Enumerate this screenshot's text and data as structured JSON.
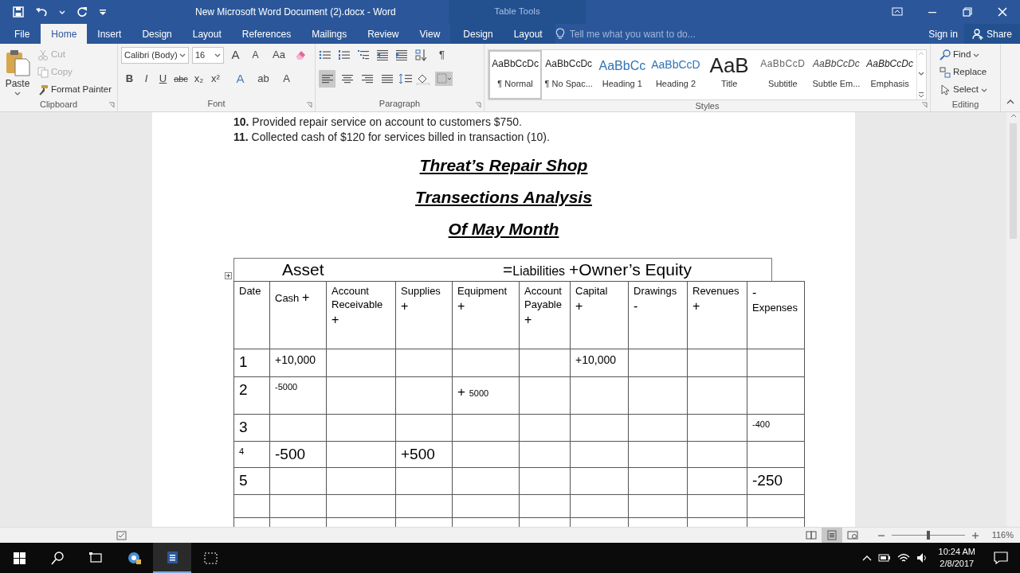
{
  "window": {
    "title": "New Microsoft Word Document (2).docx - Word",
    "context": "Table Tools"
  },
  "tabs": [
    {
      "label": "File",
      "selected": false,
      "kind": "file"
    },
    {
      "label": "Home",
      "selected": true,
      "kind": "main"
    },
    {
      "label": "Insert",
      "selected": false,
      "kind": "main"
    },
    {
      "label": "Design",
      "selected": false,
      "kind": "main"
    },
    {
      "label": "Layout",
      "selected": false,
      "kind": "main"
    },
    {
      "label": "References",
      "selected": false,
      "kind": "main"
    },
    {
      "label": "Mailings",
      "selected": false,
      "kind": "main"
    },
    {
      "label": "Review",
      "selected": false,
      "kind": "main"
    },
    {
      "label": "View",
      "selected": false,
      "kind": "main"
    },
    {
      "label": "Design",
      "selected": false,
      "kind": "context"
    },
    {
      "label": "Layout",
      "selected": false,
      "kind": "context"
    }
  ],
  "tell_me": {
    "placeholder": "Tell me what you want to do..."
  },
  "account": {
    "sign_in": "Sign in",
    "share": "Share"
  },
  "ribbon": {
    "clipboard": {
      "label": "Clipboard",
      "paste": "Paste",
      "commands": [
        {
          "label": "Cut",
          "kind": "cut",
          "disabled": true
        },
        {
          "label": "Copy",
          "kind": "copy",
          "disabled": true
        },
        {
          "label": "Format Painter",
          "kind": "painter",
          "disabled": false
        }
      ]
    },
    "font": {
      "label": "Font",
      "name": "Calibri (Body)",
      "size": "16",
      "tools": [
        {
          "glyph": "A",
          "kind": "grow"
        },
        {
          "glyph": "A",
          "kind": "shrink"
        },
        {
          "glyph": "Aa",
          "kind": "case"
        }
      ],
      "format": [
        {
          "glyph": "B",
          "kind": "bold"
        },
        {
          "glyph": "I",
          "kind": "italic"
        },
        {
          "glyph": "U",
          "kind": "underline"
        },
        {
          "glyph": "abc",
          "kind": "strike"
        },
        {
          "glyph": "x₂",
          "kind": "sub"
        },
        {
          "glyph": "x²",
          "kind": "sup"
        },
        {
          "glyph": "A",
          "kind": "effects"
        },
        {
          "glyph": "ab",
          "kind": "highlight"
        },
        {
          "glyph": "A",
          "kind": "color"
        }
      ]
    },
    "paragraph": {
      "label": "Paragraph",
      "pilcrow": "¶",
      "alignments": [
        {
          "kind": "left",
          "selected": true
        },
        {
          "kind": "center",
          "selected": false
        },
        {
          "kind": "right",
          "selected": false
        },
        {
          "kind": "justify",
          "selected": false
        }
      ]
    },
    "styles": {
      "label": "Styles",
      "items": [
        {
          "preview": "AaBbCcDc",
          "name": "¶ Normal",
          "kind": "normal",
          "selected": true
        },
        {
          "preview": "AaBbCcDc",
          "name": "¶ No Spac...",
          "kind": "nospacing",
          "selected": false
        },
        {
          "preview": "AaBbCc",
          "name": "Heading 1",
          "kind": "heading1",
          "selected": false
        },
        {
          "preview": "AaBbCcD",
          "name": "Heading 2",
          "kind": "heading2",
          "selected": false
        },
        {
          "preview": "AaB",
          "name": "Title",
          "kind": "title",
          "selected": false
        },
        {
          "preview": "AaBbCcD",
          "name": "Subtitle",
          "kind": "subtitle",
          "selected": false
        },
        {
          "preview": "AaBbCcDc",
          "name": "Subtle Em...",
          "kind": "subtle",
          "selected": false
        },
        {
          "preview": "AaBbCcDc",
          "name": "Emphasis",
          "kind": "emphasis",
          "selected": false
        }
      ]
    },
    "editing": {
      "label": "Editing",
      "commands": [
        {
          "label": "Find",
          "kind": "find"
        },
        {
          "label": "Replace",
          "kind": "replace"
        },
        {
          "label": "Select",
          "kind": "select"
        }
      ]
    }
  },
  "document": {
    "list": [
      {
        "number": "10.",
        "text": "Provided repair service on account to customers $750."
      },
      {
        "number": "11.",
        "text": "Collected cash of $120 for services billed in transaction (10)."
      }
    ],
    "headings": [
      "Threat’s Repair Shop",
      "Transections Analysis",
      "Of May Month"
    ],
    "table": {
      "equation": {
        "asset": "Asset",
        "equals": "=",
        "liabilities": "Liabilities",
        "equity": "+Owner’s Equity"
      },
      "columns": [
        {
          "label": "Date",
          "kind": "plain"
        },
        {
          "label": "Cash",
          "sign": "+",
          "kind": "inline"
        },
        {
          "label": "Account Receivable",
          "sign": "+",
          "kind": "below"
        },
        {
          "label": "Supplies",
          "sign": "+",
          "kind": "below"
        },
        {
          "label": "Equipment",
          "sign": "+",
          "kind": "below"
        },
        {
          "label": "Account Payable",
          "sign": "+",
          "kind": "below"
        },
        {
          "label": "Capital",
          "sign": "+",
          "kind": "below"
        },
        {
          "label": "Drawings",
          "sign": "-",
          "kind": "below"
        },
        {
          "label": "Revenues",
          "sign": "+",
          "kind": "below"
        },
        {
          "label": "Expenses",
          "sign": "-",
          "kind": "above"
        }
      ],
      "rows": [
        {
          "kind": "entry",
          "date": {
            "text": "1",
            "kind": "large"
          },
          "cash": {
            "text": "+10,000",
            "kind": "small"
          },
          "capital": {
            "text": "+10,000",
            "kind": "small"
          }
        },
        {
          "kind": "entry",
          "date": {
            "text": "2",
            "kind": "large"
          },
          "cash": {
            "text": "-5000",
            "kind": "tiny"
          },
          "equipment": {
            "sign": "+",
            "text": "5000",
            "kind": "tiny"
          }
        },
        {
          "kind": "entry",
          "date": {
            "text": "3",
            "kind": "large"
          },
          "expenses": {
            "text": "-400",
            "kind": "tiny"
          }
        },
        {
          "kind": "entry",
          "date": {
            "text": "4",
            "kind": "tiny"
          },
          "cash": {
            "text": "-500",
            "kind": "large"
          },
          "supplies": {
            "text": "+500",
            "kind": "large"
          }
        },
        {
          "kind": "entry",
          "date": {
            "text": "5",
            "kind": "large"
          },
          "expenses": {
            "text": "-250",
            "kind": "large"
          }
        },
        {
          "kind": "blank"
        },
        {
          "kind": "blank"
        }
      ]
    }
  },
  "status_bar": {
    "views": [
      {
        "kind": "read",
        "selected": false
      },
      {
        "kind": "print",
        "selected": true
      },
      {
        "kind": "web",
        "selected": false
      }
    ],
    "zoom": {
      "level": 0.5,
      "text": "116%"
    }
  },
  "taskbar": {
    "time": "10:24 AM",
    "date": "2/8/2017"
  }
}
